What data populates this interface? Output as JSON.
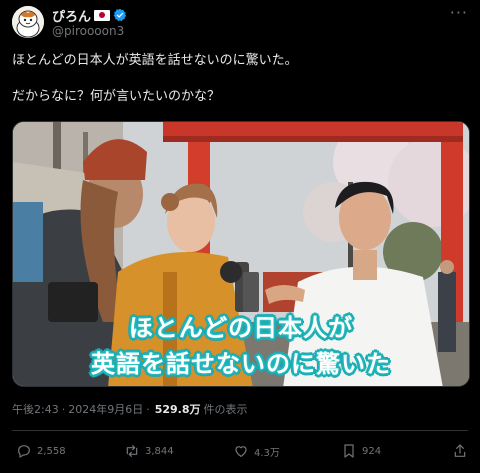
{
  "post": {
    "author": {
      "display_name": "ぴろん",
      "handle": "@piroooon3",
      "flag_icon": "japan-flag-icon",
      "verified_icon": "verified-badge-icon",
      "verified_color": "#1d9bf0"
    },
    "text_lines": [
      "ほとんどの日本人が英語を話せないのに驚いた。",
      "だからなに？何が言いたいのかな？"
    ],
    "media": {
      "caption_line1": "ほとんどの日本人が",
      "caption_line2": "英語を話せないのに驚いた"
    },
    "meta": {
      "time": "午後2:43",
      "separator": "·",
      "date": "2024年9月6日",
      "views": "529.8万",
      "views_label": "件の表示"
    },
    "actions": {
      "replies": "2,558",
      "reposts": "3,844",
      "likes": "4.3万",
      "bookmarks": "924"
    }
  },
  "colors": {
    "background": "#000000",
    "text_primary": "#e7e9ea",
    "text_secondary": "#71767b",
    "border": "#2f3336",
    "caption_outline": "#1aa7b0"
  }
}
